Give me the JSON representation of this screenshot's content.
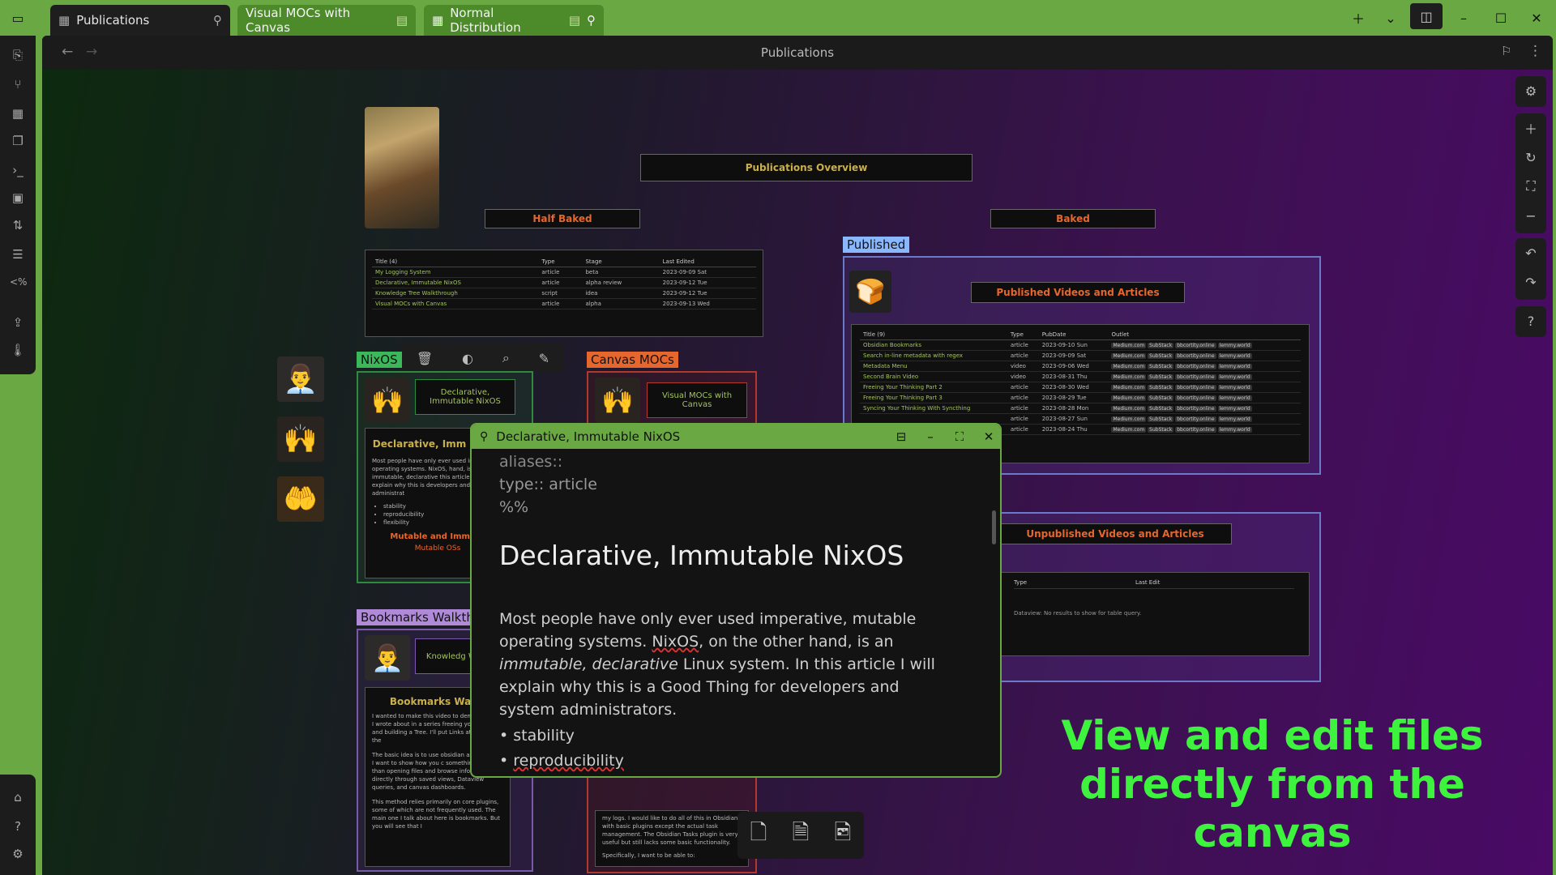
{
  "tabs": [
    {
      "label": "Publications",
      "active": true
    },
    {
      "label": "Visual MOCs with Canvas",
      "active": false
    },
    {
      "label": "Normal Distribution",
      "active": false
    }
  ],
  "header": {
    "title": "Publications"
  },
  "canvas": {
    "overview_title": "Publications Overview",
    "half_baked": "Half Baked",
    "baked": "Baked",
    "published_label": "Published",
    "published_title": "Published Videos and Articles",
    "unpublished_title": "Unpublished Videos and Articles",
    "half_baked_table": {
      "headers": [
        "Title (4)",
        "Type",
        "Stage",
        "Last Edited"
      ],
      "rows": [
        [
          "My Logging System",
          "article",
          "beta",
          "2023-09-09 Sat"
        ],
        [
          "Declarative, Immutable NixOS",
          "article",
          "alpha review",
          "2023-09-12 Tue"
        ],
        [
          "Knowledge Tree Walkthrough",
          "script",
          "idea",
          "2023-09-12 Tue"
        ],
        [
          "Visual MOCs with Canvas",
          "article",
          "alpha",
          "2023-09-13 Wed"
        ]
      ]
    },
    "published_table": {
      "headers": [
        "Title (9)",
        "Type",
        "PubDate",
        "Outlet"
      ],
      "rows": [
        [
          "Obsidian Bookmarks",
          "article",
          "2023-09-10 Sun"
        ],
        [
          "Search in-line metadata with regex",
          "article",
          "2023-09-09 Sat"
        ],
        [
          "Metadata Menu",
          "video",
          "2023-09-06 Wed"
        ],
        [
          "Second Brain Video",
          "video",
          "2023-08-31 Thu"
        ],
        [
          "Freeing Your Thinking Part 2",
          "article",
          "2023-08-30 Wed"
        ],
        [
          "Freeing Your Thinking Part 3",
          "article",
          "2023-08-29 Tue"
        ],
        [
          "Syncing Your Thinking With Syncthing",
          "article",
          "2023-08-28 Mon"
        ],
        [
          "",
          "article",
          "2023-08-27 Sun"
        ],
        [
          "",
          "article",
          "2023-08-24 Thu"
        ]
      ],
      "outlets": [
        "Medium.com",
        "SubStack",
        "bbcortity.online",
        "lemmy.world"
      ]
    },
    "unpublished_table": {
      "headers": [
        "Type",
        "Last Edit"
      ],
      "empty": "Dataview: No results to show for table query."
    },
    "nixos_group": "NixOS",
    "canvas_mocs_group": "Canvas MOCs",
    "bookmarks_group": "Bookmarks Walkth",
    "nixos_card_title": "Declarative, Immutable NixOS",
    "visual_mocs_card": "Visual MOCs with Canvas",
    "knowledge_card": "Knowledg Walkthro",
    "nixos_note_heading": "Declarative, Imm NixOS",
    "nixos_note_text": "Most people have only ever used im mutable operating systems. NixOS, hand, is an immutable, declarative this article I will explain why this is developers and system administrat",
    "nixos_bullets": [
      "stability",
      "reproducibility",
      "flexibility"
    ],
    "nixos_subheading": "Mutable and Immuta",
    "nixos_subheading2": "Mutable OSs",
    "bookmarks_heading": "Bookmarks Walkt",
    "bookmarks_text1": "I wanted to make this video to dem ideas that I wrote about in a series freeing your thinking and building a Tree. I'll put Links at the end of the",
    "bookmarks_text2": "The basic idea is to use obsidian as database. I want to show how you c something other than opening files and browse information directly through saved views, Dataview queries, and canvas dashboards.",
    "bookmarks_text3": "This method relies primarily on core plugins, some of which are not frequently used. The main one I talk about here is bookmarks. But you will see that I",
    "canvas_mocs_text": "my logs. I would like to do all of this in Obsidian with basic plugins except the actual task management. The Obsidian Tasks plugin is very useful but still lacks some basic functionality.",
    "canvas_mocs_text2": "Specifically, I want to be able to:"
  },
  "popover": {
    "title": "Declarative, Immutable NixOS",
    "frontmatter": [
      "aliases::",
      "type:: article",
      "%%"
    ],
    "heading": "Declarative, Immutable NixOS",
    "para_1": "Most people have only ever used imperative, mutable operating systems. ",
    "para_nixos": "NixOS",
    "para_2": ", on the other hand, is an ",
    "para_em": "immutable, declarative",
    "para_3": " Linux system. In this article I will explain why this is a Good Thing for developers and system administrators.",
    "bullets": [
      "stability",
      "reproducibility"
    ]
  },
  "overlay_text": "View and edit files directly from the canvas",
  "colors": {
    "accent_green": "#6aa843",
    "overlay_green": "#3df33d",
    "title_gold": "#c9b04a",
    "orange": "#e6672e",
    "published_blue": "#8ab8ff",
    "purple_group": "#b08ad8"
  }
}
